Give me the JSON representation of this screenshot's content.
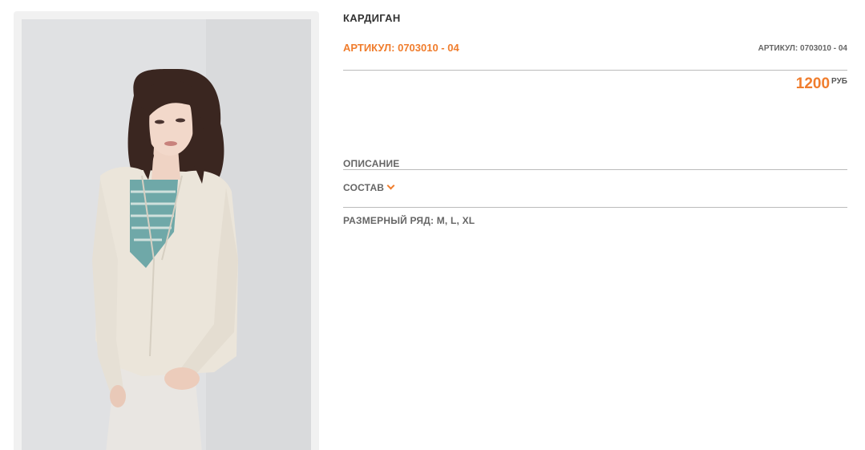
{
  "product": {
    "title": "КАРДИГАН",
    "sku_label": "АРТИКУЛ: 0703010 - 04",
    "sku_label_small": "АРТИКУЛ: 0703010 - 04",
    "price": "1200",
    "currency": "РУБ"
  },
  "sections": {
    "description": "ОПИСАНИЕ",
    "composition": "СОСТАВ",
    "sizes": "РАЗМЕРНЫЙ РЯД: M, L, XL"
  },
  "colors": {
    "accent": "#f07d2d",
    "text": "#333333",
    "muted": "#666666",
    "divider": "#bbbbbb"
  },
  "icons": {
    "composition_toggle": "chevron-down-icon"
  }
}
